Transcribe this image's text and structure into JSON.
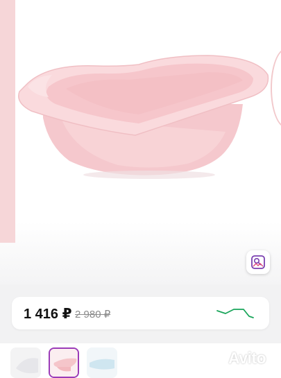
{
  "product": {
    "image_name": "pink baby bath tub",
    "colors": {
      "tub": "#f7ccd0",
      "tub_shadow": "#eeb5bb",
      "tub_rim": "#fadadd"
    }
  },
  "gallery": {
    "search_photo_icon": "image-search-icon"
  },
  "price": {
    "current": "1 416 ₽",
    "old": "2 980 ₽",
    "history_color": "#19a55a",
    "history_icon": "price-history-chart-icon"
  },
  "thumbnails": {
    "count_visible": 3,
    "active_index": 1,
    "accent": "#9b3bb8"
  },
  "watermark": {
    "text": "Avito"
  }
}
